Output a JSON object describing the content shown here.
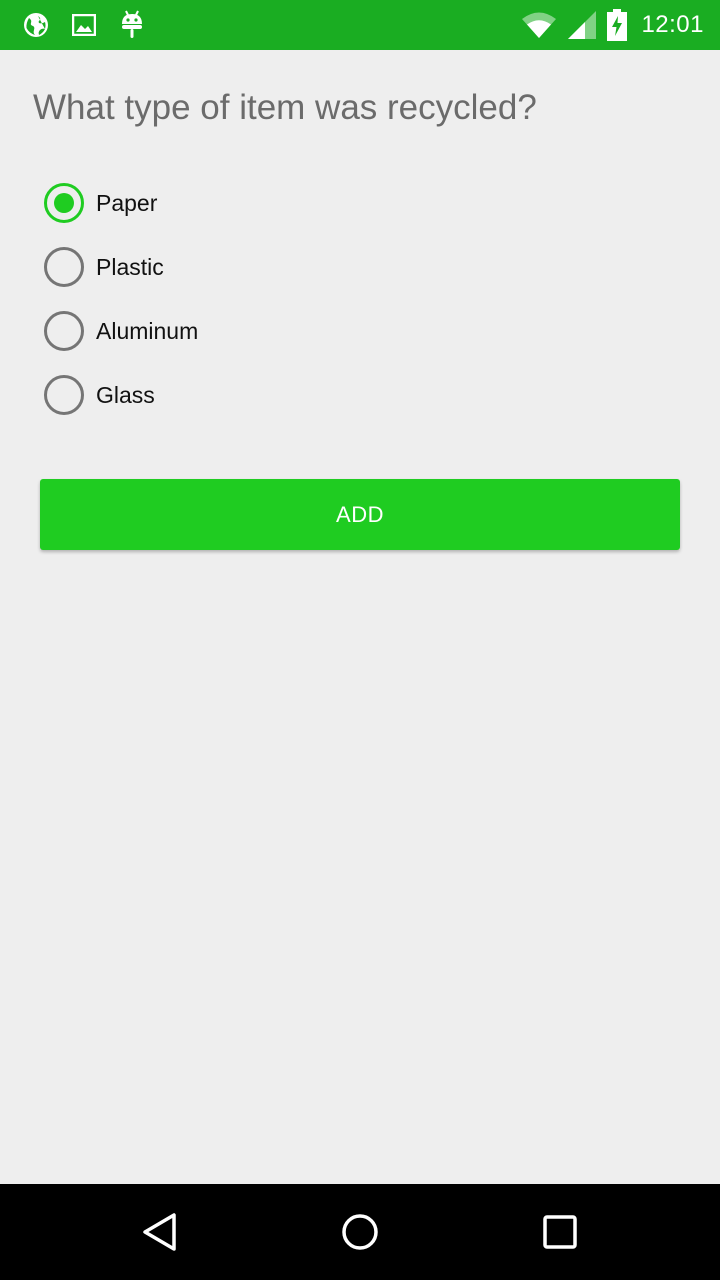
{
  "status_bar": {
    "time": "12:01",
    "left_icons": [
      "globe-icon",
      "image-icon",
      "android-icon"
    ],
    "right_icons": [
      "wifi-icon",
      "signal-icon",
      "battery-charging-icon"
    ],
    "background_color": "#1aad22"
  },
  "form": {
    "question": "What type of item was recycled?",
    "options": [
      {
        "label": "Paper",
        "checked": true
      },
      {
        "label": "Plastic",
        "checked": false
      },
      {
        "label": "Aluminum",
        "checked": false
      },
      {
        "label": "Glass",
        "checked": false
      }
    ],
    "add_button_label": "ADD",
    "accent_color": "#1fcc21"
  },
  "nav_bar": {
    "buttons": [
      "back-icon",
      "home-icon",
      "recents-icon"
    ]
  }
}
